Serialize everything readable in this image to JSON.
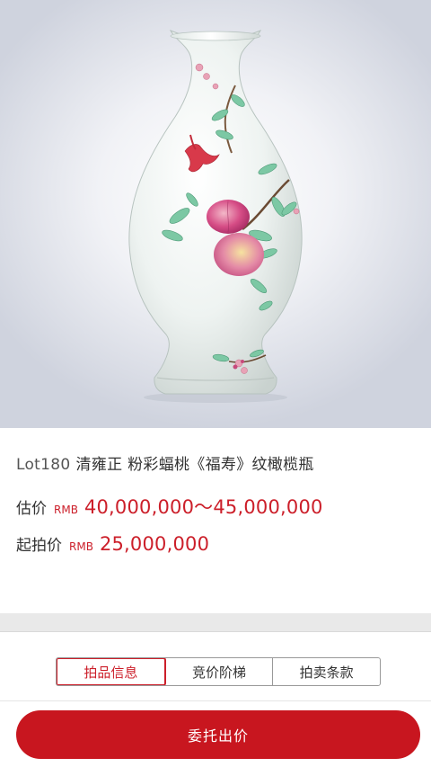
{
  "lot": {
    "number": "Lot180",
    "title": "清雍正 粉彩蝠桃《福寿》纹橄榄瓶"
  },
  "estimate": {
    "label": "估价",
    "currency": "RMB",
    "amount": "40,000,000～45,000,000"
  },
  "starting_price": {
    "label": "起拍价",
    "currency": "RMB",
    "amount": "25,000,000"
  },
  "tabs": [
    {
      "label": "拍品信息",
      "active": true
    },
    {
      "label": "竞价阶梯",
      "active": false
    },
    {
      "label": "拍卖条款",
      "active": false
    }
  ],
  "action": {
    "bid_label": "委托出价"
  },
  "colors": {
    "accent": "#c8161f",
    "price_text": "#cc1f2a",
    "band": "#e9e9e9"
  }
}
